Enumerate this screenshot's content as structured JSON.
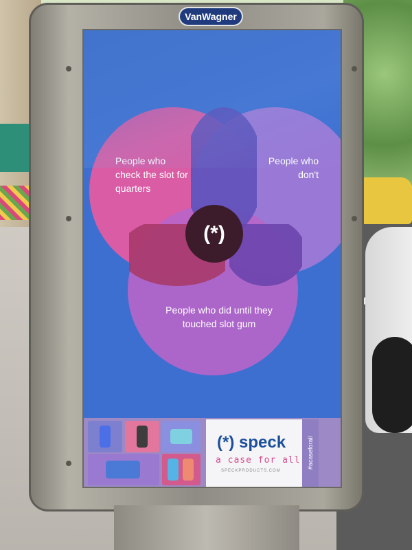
{
  "kiosk": {
    "brand": "VanWagner"
  },
  "poster": {
    "circle_left_label": "People who check the slot for quarters",
    "circle_right_label": "People who don't",
    "circle_bottom_label": "People who did until they touched slot gum",
    "center_symbol": "(*)",
    "speck_logo": "(*) speck",
    "speck_tagline": "a case for all",
    "speck_url": "SPECKPRODUCTS.COM",
    "hashtag": "#acaseforall"
  },
  "colors": {
    "left_circle": "#e65aa0",
    "right_circle": "#a47ad6",
    "bottom_circle": "#b865c9",
    "poster_bg": "#3d6fd1",
    "speck_blue": "#1b4f9c",
    "tagline_pink": "#d34b8d"
  }
}
